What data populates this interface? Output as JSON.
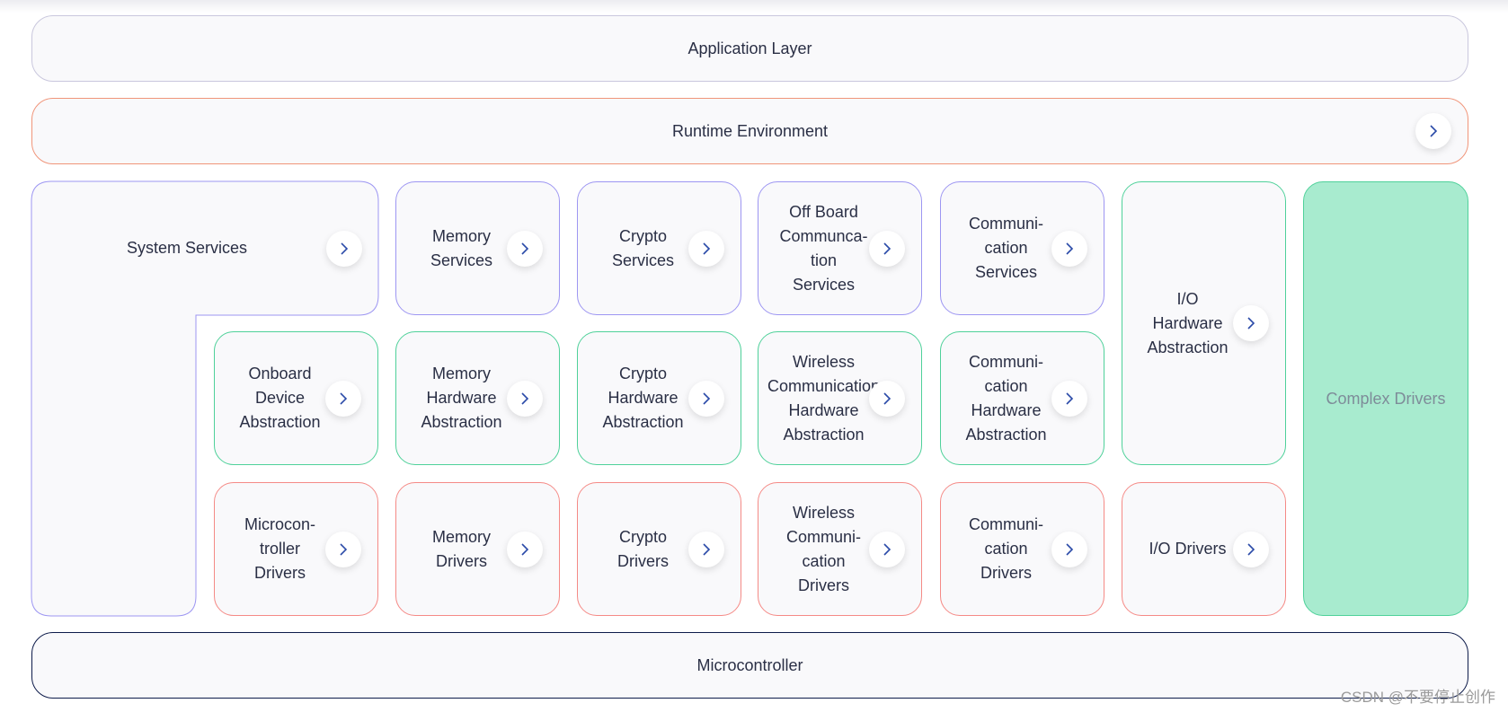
{
  "layers": {
    "application": "Application Layer",
    "runtime": "Runtime Environment",
    "microcontroller": "Microcontroller",
    "system_services": "System Services",
    "complex_drivers": "Complex Drivers"
  },
  "cells": [
    {
      "label": "Memory\nServices",
      "kind": "service"
    },
    {
      "label": "Crypto\nServices",
      "kind": "service"
    },
    {
      "label": "Off Board\nCommunca-\ntion\nServices",
      "kind": "service"
    },
    {
      "label": "Communi-\ncation\nServices",
      "kind": "service"
    },
    {
      "label": "Onboard\nDevice\nAbstraction",
      "kind": "abstraction"
    },
    {
      "label": "Memory\nHardware\nAbstraction",
      "kind": "abstraction"
    },
    {
      "label": "Crypto\nHardware\nAbstraction",
      "kind": "abstraction"
    },
    {
      "label": "Wireless\nCommunication\nHardware\nAbstraction",
      "kind": "abstraction"
    },
    {
      "label": "Communi-\ncation\nHardware\nAbstraction",
      "kind": "abstraction"
    },
    {
      "label": "I/O\nHardware\nAbstraction",
      "kind": "abstraction"
    },
    {
      "label": "Microcon-\ntroller\nDrivers",
      "kind": "driver"
    },
    {
      "label": "Memory\nDrivers",
      "kind": "driver"
    },
    {
      "label": "Crypto\nDrivers",
      "kind": "driver"
    },
    {
      "label": "Wireless\nCommuni-\ncation\nDrivers",
      "kind": "driver"
    },
    {
      "label": "Communi-\ncation\nDrivers",
      "kind": "driver"
    },
    {
      "label": "I/O Drivers",
      "kind": "driver"
    }
  ],
  "icons": {
    "expand": "chevron-right-icon"
  },
  "colors": {
    "service_border": "#9d96f2",
    "abstraction_border": "#4fd19a",
    "driver_border": "#f58a86",
    "runtime_border": "#f0957a",
    "microcontroller_border": "#0d1b4a",
    "complex_fill": "#a8ebcf",
    "chevron": "#2a4aa8"
  },
  "watermark": "CSDN @不要停止创作"
}
